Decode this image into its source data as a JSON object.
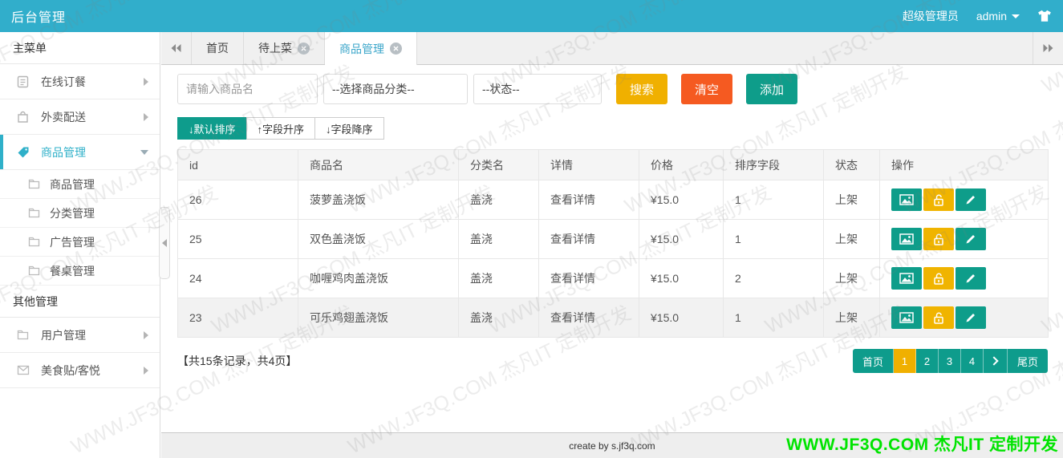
{
  "topbar": {
    "title": "后台管理",
    "role": "超级管理员",
    "username": "admin"
  },
  "tabs": {
    "home": "首页",
    "pending": "待上菜",
    "product": "商品管理"
  },
  "sidebar": {
    "main_section": "主菜单",
    "other_section": "其他管理",
    "online_order": "在线订餐",
    "delivery": "外卖配送",
    "product_mgmt": "商品管理",
    "sub_product": "商品管理",
    "sub_category": "分类管理",
    "sub_ad": "广告管理",
    "sub_table": "餐桌管理",
    "user_mgmt": "用户管理",
    "food_post": "美食贴/客悦"
  },
  "search": {
    "keyword_placeholder": "请输入商品名",
    "category_value": "--选择商品分类--",
    "status_value": "--状态--",
    "search_label": "搜索",
    "clear_label": "清空",
    "add_label": "添加"
  },
  "sort": {
    "default_label": "↓默认排序",
    "asc_label": "↑字段升序",
    "desc_label": "↓字段降序"
  },
  "table": {
    "headers": [
      "id",
      "商品名",
      "分类名",
      "详情",
      "价格",
      "排序字段",
      "状态",
      "操作"
    ],
    "rows": [
      {
        "id": "26",
        "name": "菠萝盖浇饭",
        "category": "盖浇",
        "detail": "查看详情",
        "price": "¥15.0",
        "sort": "1",
        "status": "上架"
      },
      {
        "id": "25",
        "name": "双色盖浇饭",
        "category": "盖浇",
        "detail": "查看详情",
        "price": "¥15.0",
        "sort": "1",
        "status": "上架"
      },
      {
        "id": "24",
        "name": "咖喱鸡肉盖浇饭",
        "category": "盖浇",
        "detail": "查看详情",
        "price": "¥15.0",
        "sort": "2",
        "status": "上架"
      },
      {
        "id": "23",
        "name": "可乐鸡翅盖浇饭",
        "category": "盖浇",
        "detail": "查看详情",
        "price": "¥15.0",
        "sort": "1",
        "status": "上架"
      }
    ]
  },
  "pager": {
    "summary": "【共15条记录，共4页】",
    "first_label": "首页",
    "pages": [
      "1",
      "2",
      "3",
      "4"
    ],
    "last_label": "尾页"
  },
  "footer": {
    "credit": "create by s.jf3q.com"
  },
  "watermark": {
    "text": "WWW.JF3Q.COM 杰凡IT  定制开发"
  },
  "colors": {
    "topbar": "#31aecb",
    "teal": "#0e9c8c",
    "yellow": "#f0b000",
    "red": "#f55a21",
    "tab_active_text": "#3ba6ca",
    "green_watermark": "#00e400"
  }
}
